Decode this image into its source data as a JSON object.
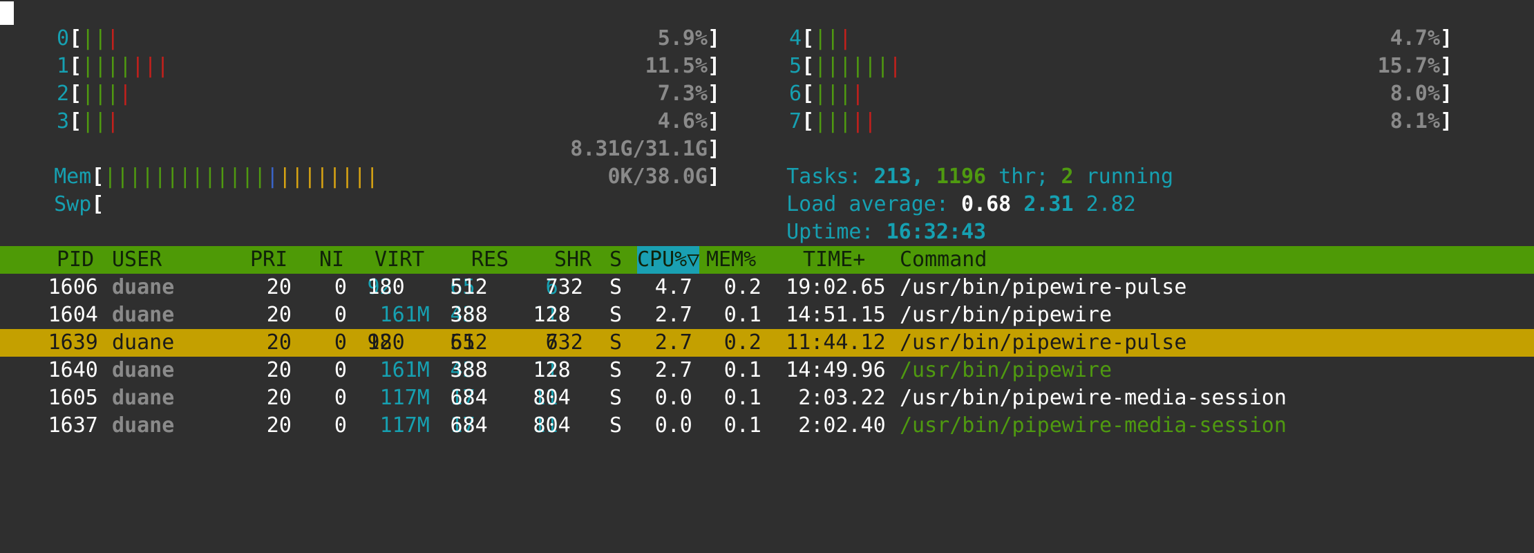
{
  "cpus": [
    {
      "id": "0",
      "pct": "5.9%",
      "ticks": [
        [
          "g",
          "g"
        ],
        [
          "r"
        ]
      ]
    },
    {
      "id": "1",
      "pct": "11.5%",
      "ticks": [
        [
          "g",
          "g",
          "g",
          "g"
        ],
        [
          "r",
          "r",
          "r"
        ]
      ]
    },
    {
      "id": "2",
      "pct": "7.3%",
      "ticks": [
        [
          "g",
          "g",
          "g"
        ],
        [
          "r"
        ]
      ]
    },
    {
      "id": "3",
      "pct": "4.6%",
      "ticks": [
        [
          "g",
          "g"
        ],
        [
          "r"
        ]
      ]
    },
    {
      "id": "4",
      "pct": "4.7%",
      "ticks": [
        [
          "g",
          "g"
        ],
        [
          "r"
        ]
      ]
    },
    {
      "id": "5",
      "pct": "15.7%",
      "ticks": [
        [
          "g",
          "g",
          "g",
          "g",
          "g",
          "g"
        ],
        [
          "r"
        ]
      ]
    },
    {
      "id": "6",
      "pct": "8.0%",
      "ticks": [
        [
          "g",
          "g",
          "g"
        ],
        [
          "r"
        ]
      ]
    },
    {
      "id": "7",
      "pct": "8.1%",
      "ticks": [
        [
          "g",
          "g",
          "g"
        ],
        [
          "r",
          "r"
        ]
      ]
    }
  ],
  "mem": {
    "label": "Mem",
    "value": "8.31G/31.1G"
  },
  "swp": {
    "label": "Swp",
    "value": "0K/38.0G"
  },
  "tasks": {
    "label": "Tasks: ",
    "count": "213",
    "sep": ", ",
    "threads": "1196",
    "thr_label": " thr; ",
    "running": "2",
    "running_label": " running"
  },
  "load": {
    "label": "Load average: ",
    "l1": "0.68",
    "l5": "2.31",
    "l15": "2.82"
  },
  "uptime": {
    "label": "Uptime: ",
    "value": "16:32:43"
  },
  "columns": {
    "pid": "PID",
    "user": "USER",
    "pri": "PRI",
    "ni": "NI",
    "virt": "VIRT",
    "res": "RES",
    "shr": "SHR",
    "s": "S",
    "cpu": "CPU%▽",
    "mem": "MEM%",
    "time": "TIME+",
    "command": "Command"
  },
  "processes": [
    {
      "pid": "1606",
      "user": "duane",
      "pri": "20",
      "ni": "0",
      "virt_a": "92",
      "virt_b": "180",
      "res_a": "65",
      "res_b": "512",
      "shr_a": "6",
      "shr_b": "732",
      "s": "S",
      "cpu": "4.7",
      "mem": "0.2",
      "time": "19:02.65",
      "command": "/usr/bin/pipewire-pulse",
      "thread": false
    },
    {
      "pid": "1604",
      "user": "duane",
      "pri": "20",
      "ni": "0",
      "virt_a": "161M",
      "virt_b": "",
      "res_a": "43",
      "res_b": "388",
      "shr_a": "11",
      "shr_b": "128",
      "s": "S",
      "cpu": "2.7",
      "mem": "0.1",
      "time": "14:51.15",
      "command": "/usr/bin/pipewire",
      "thread": false
    },
    {
      "pid": "1639",
      "user": "duane",
      "pri": "20",
      "ni": "0",
      "virt_a": "92",
      "virt_b": "180",
      "res_a": "65",
      "res_b": "512",
      "shr_a": "6",
      "shr_b": "732",
      "s": "S",
      "cpu": "2.7",
      "mem": "0.2",
      "time": "11:44.12",
      "command": "/usr/bin/pipewire-pulse",
      "thread": true
    },
    {
      "pid": "1640",
      "user": "duane",
      "pri": "20",
      "ni": "0",
      "virt_a": "161M",
      "virt_b": "",
      "res_a": "43",
      "res_b": "388",
      "shr_a": "11",
      "shr_b": "128",
      "s": "S",
      "cpu": "2.7",
      "mem": "0.1",
      "time": "14:49.96",
      "command": "/usr/bin/pipewire",
      "thread": true
    },
    {
      "pid": "1605",
      "user": "duane",
      "pri": "20",
      "ni": "0",
      "virt_a": "117M",
      "virt_b": "",
      "res_a": "17",
      "res_b": "684",
      "shr_a": "11",
      "shr_b": "804",
      "s": "S",
      "cpu": "0.0",
      "mem": "0.1",
      "time": "2:03.22",
      "command": "/usr/bin/pipewire-media-session",
      "thread": false
    },
    {
      "pid": "1637",
      "user": "duane",
      "pri": "20",
      "ni": "0",
      "virt_a": "117M",
      "virt_b": "",
      "res_a": "17",
      "res_b": "684",
      "shr_a": "11",
      "shr_b": "804",
      "s": "S",
      "cpu": "0.0",
      "mem": "0.1",
      "time": "2:02.40",
      "command": "/usr/bin/pipewire-media-session",
      "thread": true
    }
  ],
  "selected_index": 2,
  "colors": {
    "green": "#4e9a06",
    "cyan": "#16a0b1",
    "yellow": "#c4a000",
    "red": "#c4201c",
    "background": "#2f2f2f"
  }
}
